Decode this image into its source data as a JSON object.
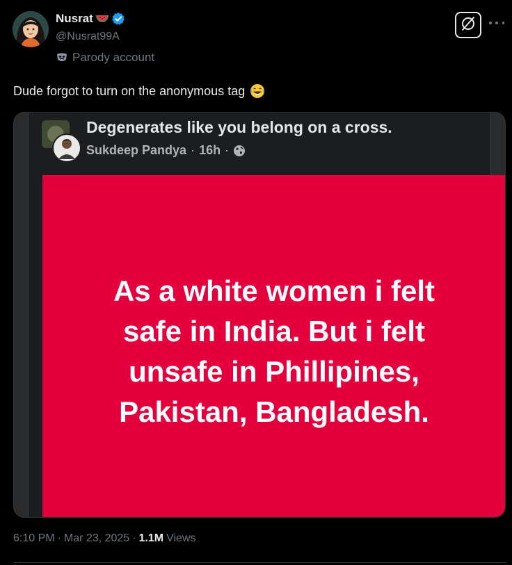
{
  "author": {
    "display_name": "Nusrat",
    "name_emoji": "watermelon-icon",
    "verified_icon": "verified-badge-icon",
    "handle": "@Nusrat99A",
    "parody_label": "Parody account",
    "parody_icon": "mask-icon"
  },
  "actions": {
    "grok_icon": "grok-icon",
    "more_icon": "more-icon"
  },
  "tweet": {
    "text": "Dude forgot to turn on the anonymous tag",
    "emoji": "laughing-tears-icon"
  },
  "media": {
    "fb_post_title": "Degenerates like you belong on a cross.",
    "fb_author": "Sukdeep Pandya",
    "fb_sep1": "·",
    "fb_time": "16h",
    "fb_sep2": "·",
    "fb_privacy_icon": "globe-icon",
    "card_text": "As a white women i felt\nsafe in India. But i felt\nunsafe in Phillipines,\nPakistan, Bangladesh.",
    "card_color": "#e4003d"
  },
  "meta": {
    "time": "6:10 PM",
    "sep": "·",
    "date": "Mar 23, 2025",
    "sep2": "·",
    "views_count": "1.1M",
    "views_label": "Views"
  },
  "colors": {
    "background": "#000000",
    "text": "#e7e9ea",
    "muted": "#71767b",
    "verified": "#1d9bf0"
  }
}
